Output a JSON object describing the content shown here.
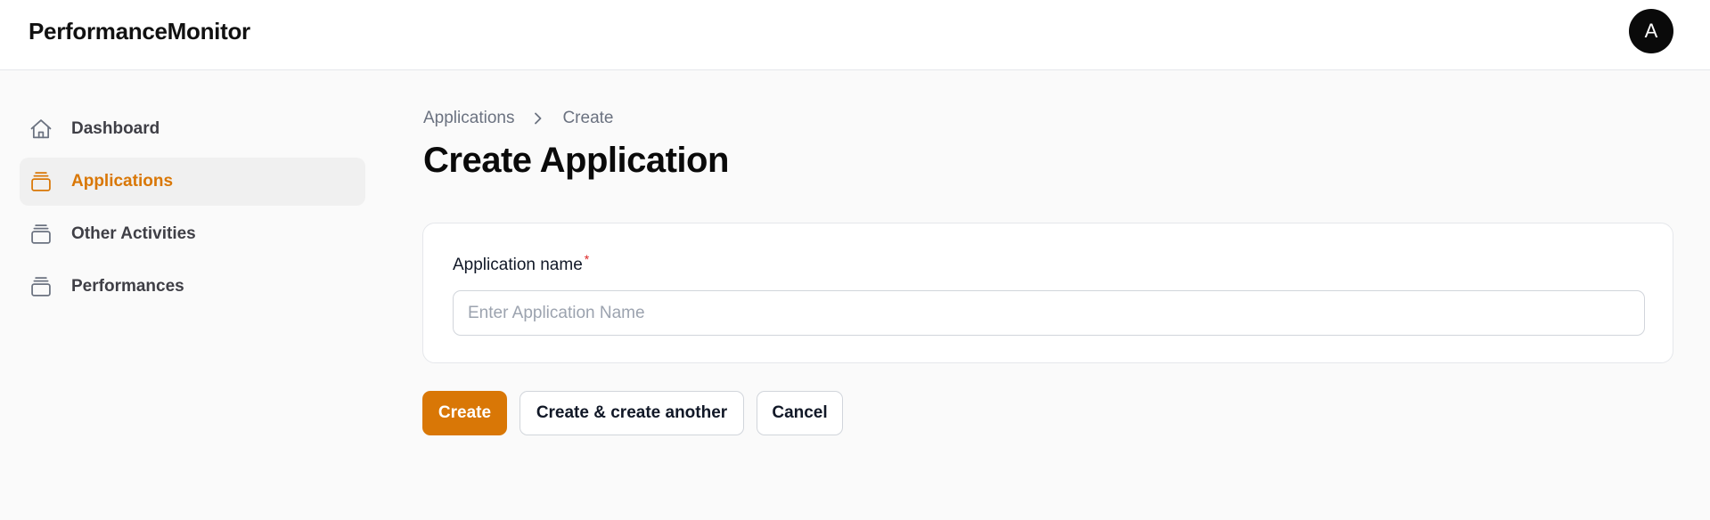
{
  "header": {
    "brand": "PerformanceMonitor",
    "avatar_initial": "A"
  },
  "sidebar": {
    "items": [
      {
        "label": "Dashboard",
        "icon": "home-icon",
        "active": false
      },
      {
        "label": "Applications",
        "icon": "stack-icon",
        "active": true
      },
      {
        "label": "Other Activities",
        "icon": "stack-icon",
        "active": false
      },
      {
        "label": "Performances",
        "icon": "stack-icon",
        "active": false
      }
    ]
  },
  "breadcrumb": {
    "items": [
      "Applications",
      "Create"
    ]
  },
  "page": {
    "title": "Create Application"
  },
  "form": {
    "field_label": "Application name",
    "required_mark": "*",
    "input_value": "",
    "input_placeholder": "Enter Application Name"
  },
  "actions": {
    "create_label": "Create",
    "create_another_label": "Create & create another",
    "cancel_label": "Cancel"
  },
  "colors": {
    "accent": "#d97706",
    "required": "#dc2626",
    "muted_text": "#6b7280"
  }
}
